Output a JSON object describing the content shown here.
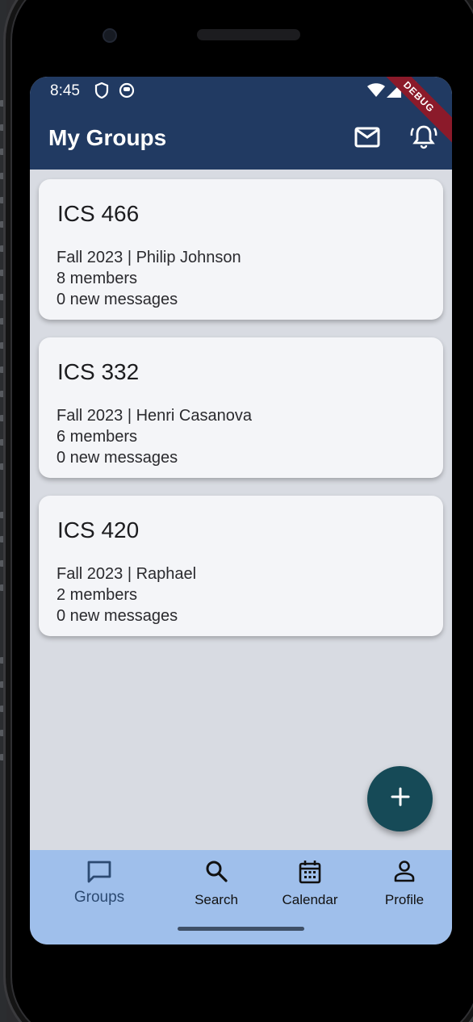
{
  "status_bar": {
    "time": "8:45",
    "debug_label": "DEBUG"
  },
  "app_bar": {
    "title": "My Groups",
    "actions": [
      "mail-icon",
      "notifications-icon"
    ]
  },
  "groups": [
    {
      "title": "ICS 466",
      "term_instructor": "Fall 2023 | Philip Johnson",
      "members": "8 members",
      "messages": "0 new messages"
    },
    {
      "title": "ICS 332",
      "term_instructor": "Fall 2023 | Henri Casanova",
      "members": "6 members",
      "messages": "0 new messages"
    },
    {
      "title": "ICS 420",
      "term_instructor": "Fall 2023 | Raphael",
      "members": "2 members",
      "messages": "0 new messages"
    }
  ],
  "bottom_nav": {
    "items": [
      {
        "label": "Groups",
        "icon": "chat-icon",
        "active": true
      },
      {
        "label": "Search",
        "icon": "search-icon",
        "active": false
      },
      {
        "label": "Calendar",
        "icon": "calendar-icon",
        "active": false
      },
      {
        "label": "Profile",
        "icon": "person-icon",
        "active": false
      }
    ]
  },
  "colors": {
    "app_bar": "#213a62",
    "background": "#d8dbe2",
    "card": "#f4f5f8",
    "fab": "#164a57",
    "nav_bar": "#9fbfeb"
  }
}
